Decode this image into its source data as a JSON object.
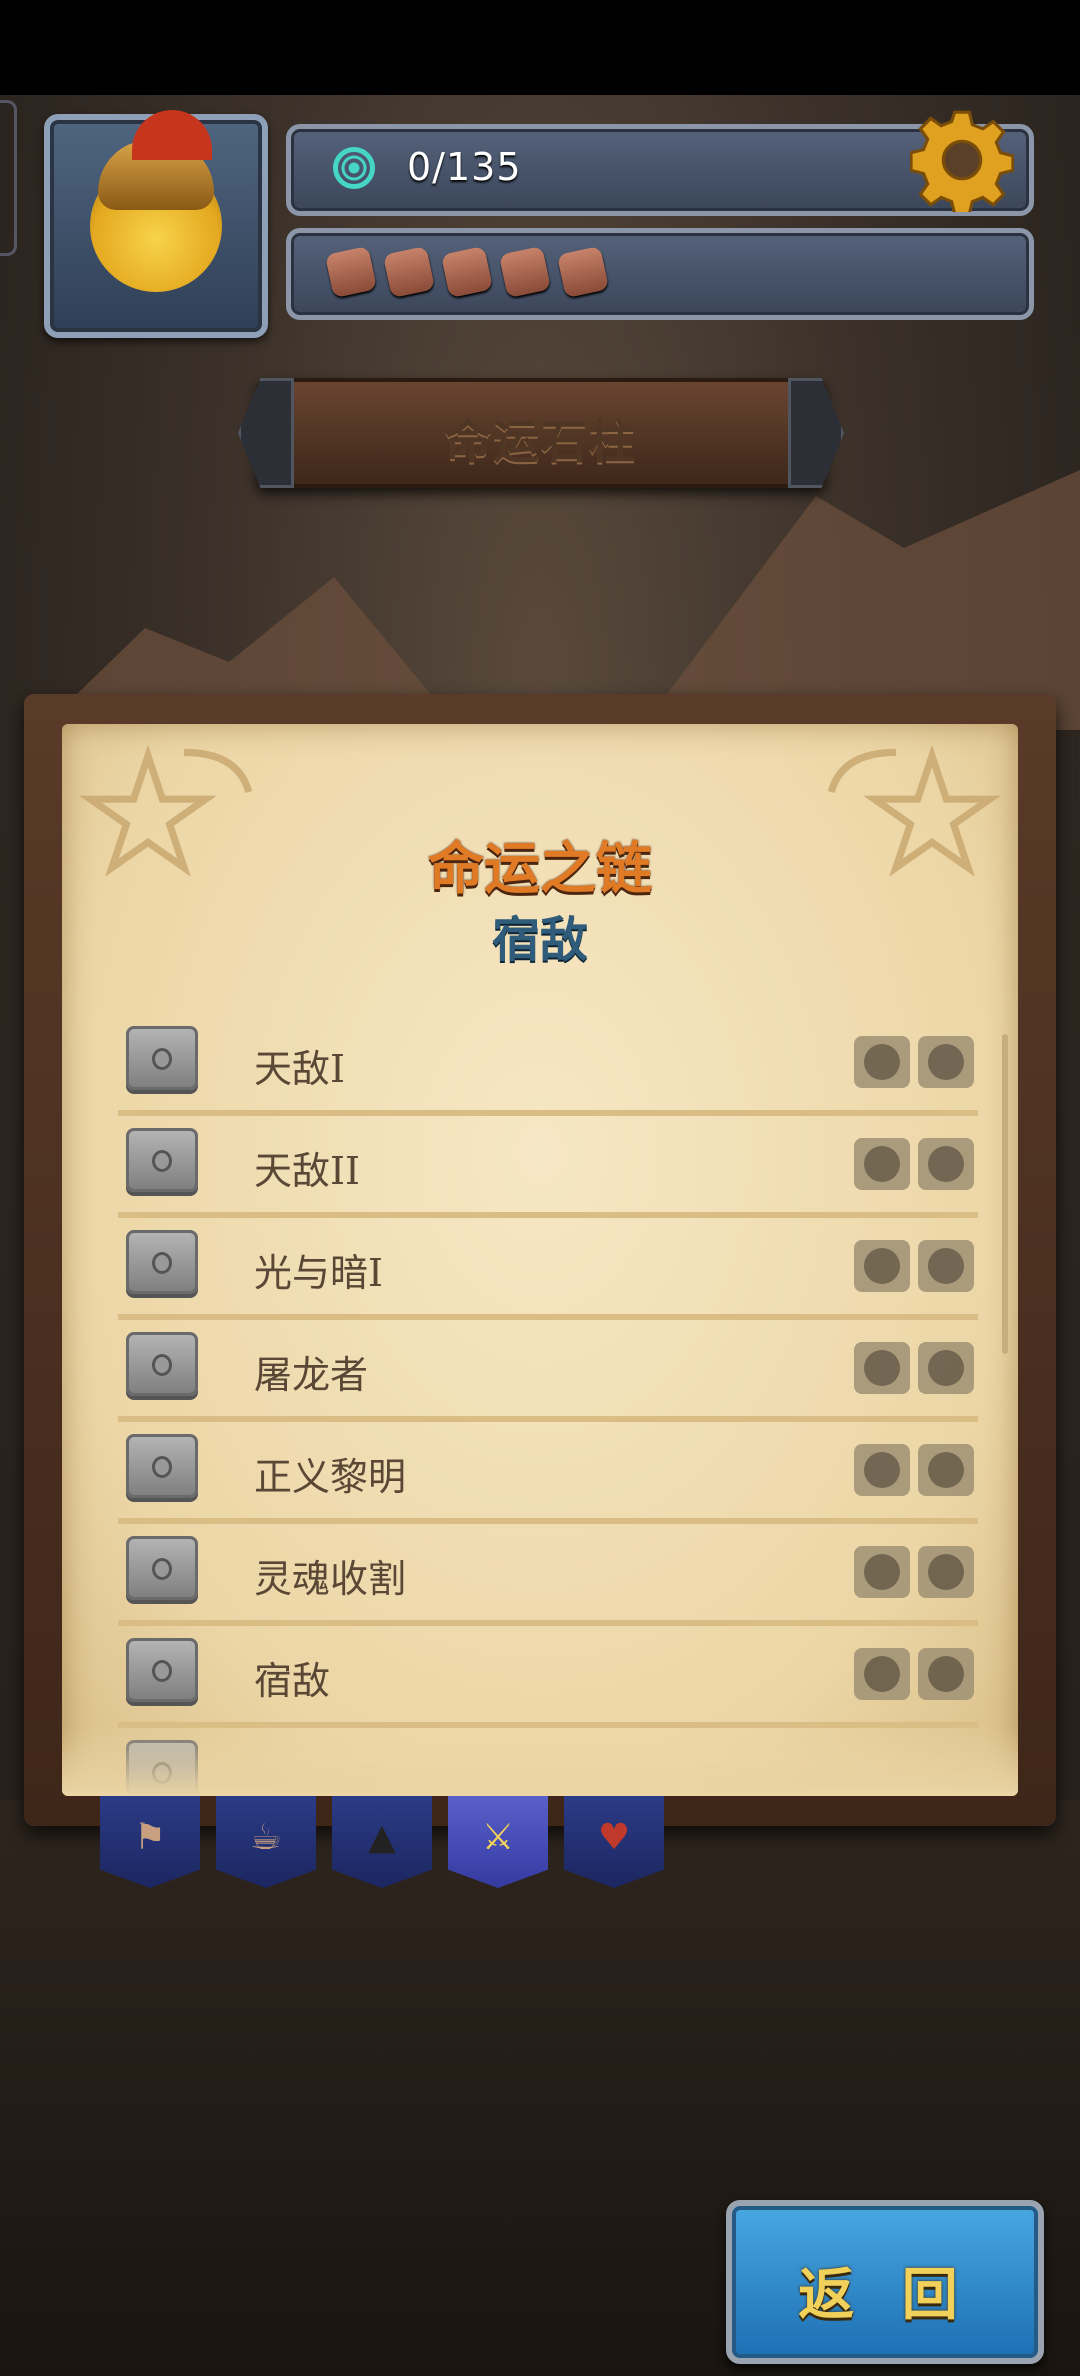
{
  "currency": {
    "value": "0/135",
    "icon": "spiral-icon",
    "color": "#45d6c6"
  },
  "tokens": {
    "count": 5,
    "icon": "stone-token-icon"
  },
  "settings": {
    "icon": "gear-icon"
  },
  "location_title": "命运石柱",
  "panel": {
    "heading": "命运之链",
    "subheading": "宿敌",
    "rows": [
      {
        "label": "天敌I"
      },
      {
        "label": "天敌II"
      },
      {
        "label": "光与暗I"
      },
      {
        "label": "屠龙者"
      },
      {
        "label": "正义黎明"
      },
      {
        "label": "灵魂收割"
      },
      {
        "label": "宿敌"
      }
    ]
  },
  "tabs": [
    {
      "icon": "signpost-icon",
      "active": false
    },
    {
      "icon": "tavern-mugs-icon",
      "active": false
    },
    {
      "icon": "graduation-cap-icon",
      "active": false
    },
    {
      "icon": "crossed-swords-icon",
      "active": true
    },
    {
      "icon": "heart-arrow-icon",
      "active": false
    }
  ],
  "back_button": {
    "label": "返 回"
  },
  "colors": {
    "accent_orange": "#e07a25",
    "accent_blue": "#2f5c7a",
    "button_blue": "#1d6fb4"
  }
}
